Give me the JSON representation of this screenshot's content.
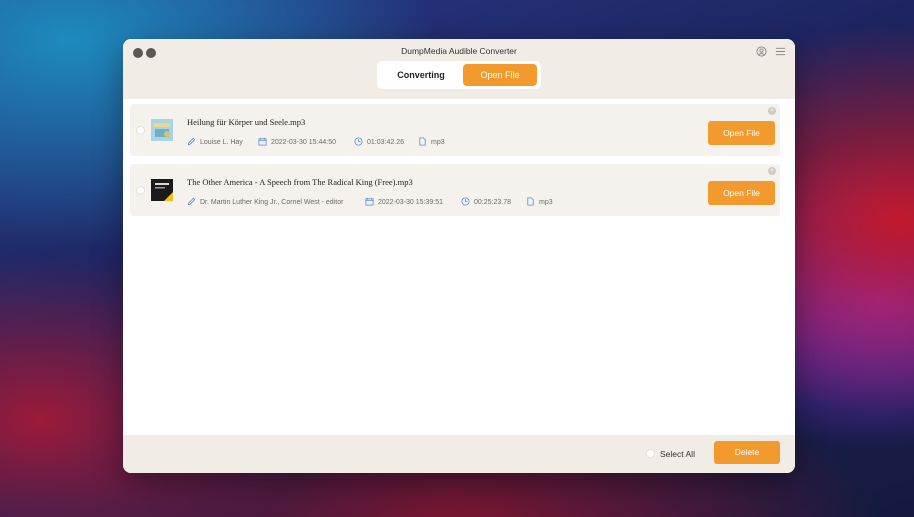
{
  "app": {
    "title": "DumpMedia Audible Converter",
    "accent_color": "#f39a2f"
  },
  "tabs": [
    {
      "label": "Converting",
      "active": false
    },
    {
      "label": "Open File",
      "active": true
    }
  ],
  "header_icons": [
    "user-icon",
    "menu-icon"
  ],
  "files": [
    {
      "filename": "Heilung für Körper und Seele.mp3",
      "author": "Louise L. Hay",
      "date": "2022-03-30 15:44:50",
      "duration": "01:03:42.26",
      "format": "mp3",
      "action_label": "Open File"
    },
    {
      "filename": "The Other America - A Speech from The Radical King (Free).mp3",
      "author": "Dr. Martin Luther King Jr., Cornel West - editor",
      "date": "2022-03-30 15:39:51",
      "duration": "00:25:23.78",
      "format": "mp3",
      "action_label": "Open File"
    }
  ],
  "footer": {
    "select_all_label": "Select All",
    "delete_label": "Delete"
  }
}
